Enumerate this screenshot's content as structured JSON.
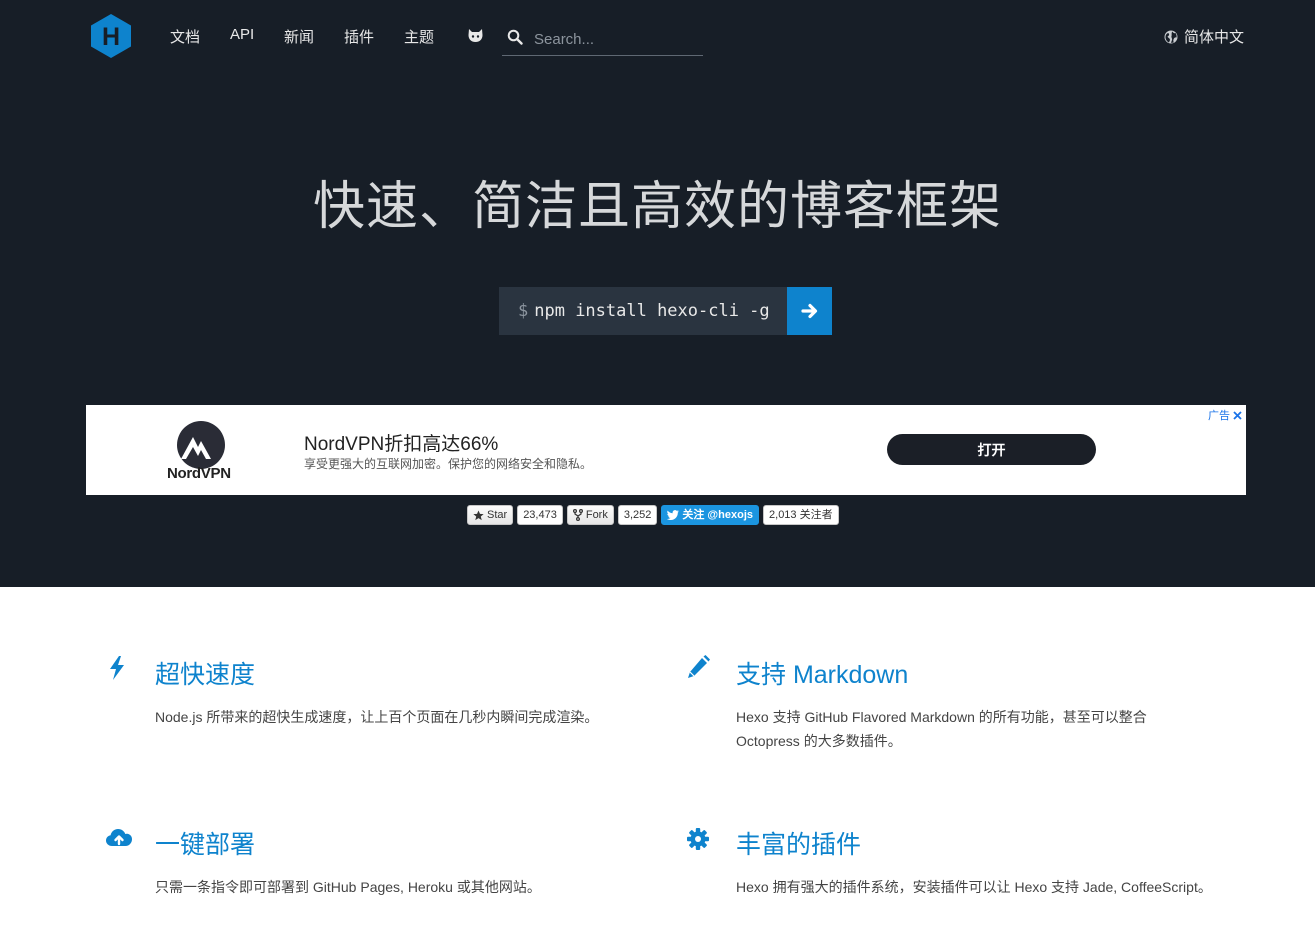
{
  "header": {
    "logo_letter": "H",
    "nav": [
      {
        "label": "文档"
      },
      {
        "label": "API"
      },
      {
        "label": "新闻"
      },
      {
        "label": "插件"
      },
      {
        "label": "主题"
      }
    ],
    "search": {
      "placeholder": "Search..."
    },
    "language": "简体中文"
  },
  "hero": {
    "title": "快速、简洁且高效的博客框架",
    "install_prompt": "$",
    "install_command": "npm install hexo-cli -g"
  },
  "ad": {
    "brand": "NordVPN",
    "title": "NordVPN折扣高达66%",
    "description": "享受更强大的互联网加密。保护您的网络安全和隐私。",
    "cta": "打开",
    "ad_label": "广告"
  },
  "social": {
    "star_label": "Star",
    "star_count": "23,473",
    "fork_label": "Fork",
    "fork_count": "3,252",
    "follow_label": "关注 @hexojs",
    "followers": "2,013 关注者"
  },
  "features": [
    {
      "icon": "bolt-icon",
      "title": "超快速度",
      "description": "Node.js 所带来的超快生成速度，让上百个页面在几秒内瞬间完成渲染。"
    },
    {
      "icon": "pencil-icon",
      "title": "支持 Markdown",
      "description": "Hexo 支持 GitHub Flavored Markdown 的所有功能，甚至可以整合 Octopress 的大多数插件。"
    },
    {
      "icon": "cloud-upload-icon",
      "title": "一键部署",
      "description": "只需一条指令即可部署到 GitHub Pages, Heroku 或其他网站。"
    },
    {
      "icon": "gear-icon",
      "title": "丰富的插件",
      "description": "Hexo 拥有强大的插件系统，安装插件可以让 Hexo 支持 Jade, CoffeeScript。"
    }
  ],
  "colors": {
    "hero_bg": "#171e27",
    "accent": "#0e83cd",
    "install_bg": "#2a3440"
  }
}
